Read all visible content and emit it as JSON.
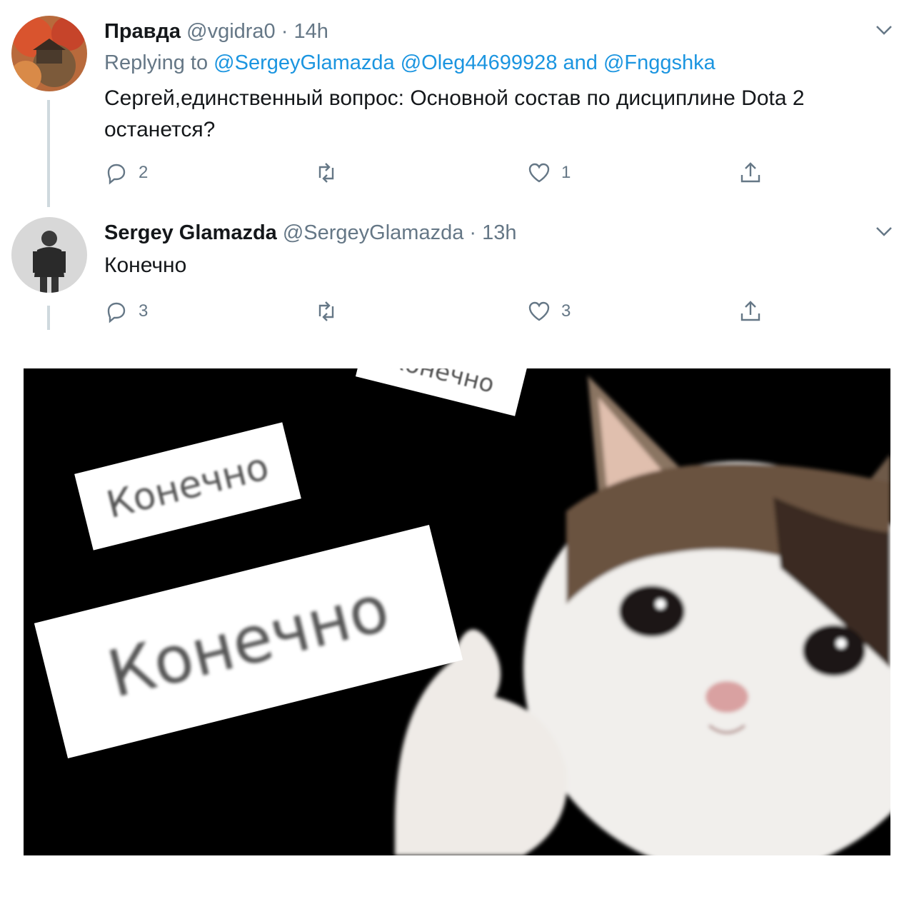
{
  "tweets": [
    {
      "name": "Правда",
      "handle": "@vgidra0",
      "separator": "·",
      "time": "14h",
      "replying_prefix": "Replying to",
      "mentions": [
        "@SergeyGlamazda",
        "@Oleg44699928"
      ],
      "mentions_joiner": "and",
      "last_mention": "@Fnggshka",
      "text": "Сергей,единственный вопрос: Основной состав по дисциплине Dota 2 останется?",
      "actions": {
        "reply": "2",
        "retweet": "",
        "like": "1"
      }
    },
    {
      "name": "Sergey Glamazda",
      "handle": "@SergeyGlamazda",
      "separator": "·",
      "time": "13h",
      "text": "Конечно",
      "actions": {
        "reply": "3",
        "retweet": "",
        "like": "3"
      }
    }
  ],
  "meme": {
    "card_text": "Конечно",
    "description_colors": {
      "background": "#000000",
      "card": "#ffffff"
    }
  },
  "icons": [
    "chevron-down-icon",
    "reply-icon",
    "retweet-icon",
    "like-icon",
    "share-icon"
  ],
  "colors": {
    "link": "#1b95e0",
    "meta": "#657786",
    "text": "#14171a"
  }
}
